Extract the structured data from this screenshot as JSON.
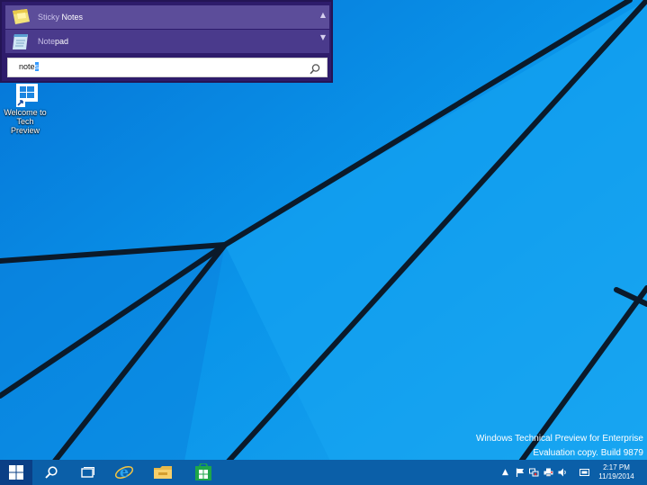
{
  "search_results": [
    {
      "match": "Sticky ",
      "rest": "Notes",
      "icon": "sticky-notes-icon"
    },
    {
      "match": "Note",
      "rest": "pad",
      "icon": "notepad-icon"
    }
  ],
  "search_box": {
    "typed": "note",
    "selected": "s"
  },
  "desktop_icon": {
    "label_line1": "Welcome to",
    "label_line2": "Tech Preview"
  },
  "watermark": {
    "line1": "Windows Technical Preview for Enterprise",
    "line2": "Evaluation copy. Build 9879"
  },
  "clock": {
    "time": "2:17 PM",
    "date": "11/19/2014"
  },
  "colors": {
    "desktop": "#0a8fe3",
    "panel": "#2e1c6b",
    "result_hover": "#5c4d9a",
    "result": "#4a3a8c",
    "taskbar": "#0b5fa8"
  }
}
